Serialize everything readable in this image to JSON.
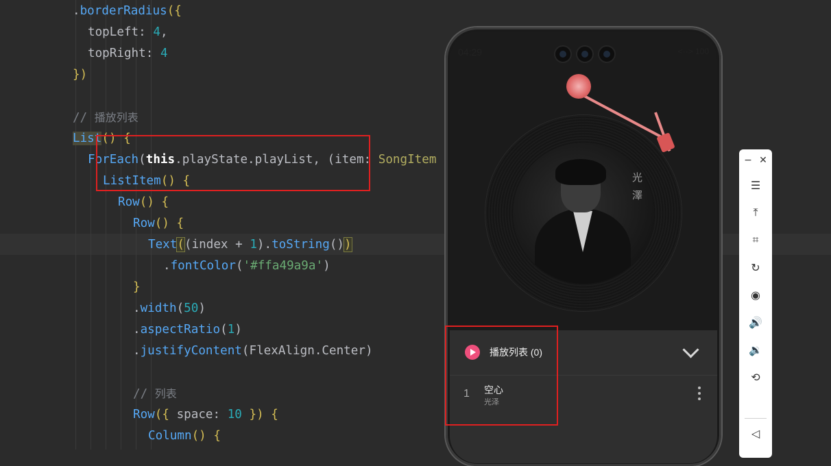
{
  "editor": {
    "lines": [
      {
        "segments": [
          {
            "t": ".",
            "c": "c-plain"
          },
          {
            "t": "borderRadius",
            "c": "c-fn"
          },
          {
            "t": "({",
            "c": "c-brace"
          }
        ]
      },
      {
        "segments": [
          {
            "t": "topLeft",
            "c": "c-plain"
          },
          {
            "t": ": ",
            "c": "c-plain"
          },
          {
            "t": "4",
            "c": "c-num"
          },
          {
            "t": ",",
            "c": "c-plain"
          }
        ]
      },
      {
        "segments": [
          {
            "t": "topRight",
            "c": "c-plain"
          },
          {
            "t": ": ",
            "c": "c-plain"
          },
          {
            "t": "4",
            "c": "c-num"
          }
        ]
      },
      {
        "segments": [
          {
            "t": "})",
            "c": "c-brace"
          }
        ]
      },
      {
        "segments": []
      },
      {
        "segments": [
          {
            "t": "// ",
            "c": "c-cm"
          },
          {
            "t": "播放列表",
            "c": "c-cm zh"
          }
        ]
      },
      {
        "segments": [
          {
            "t": "List",
            "c": "c-fn list-box"
          },
          {
            "t": "() {",
            "c": "c-brace"
          }
        ]
      },
      {
        "segments": [
          {
            "t": "ForEach",
            "c": "c-fn"
          },
          {
            "t": "(",
            "c": "c-plain"
          },
          {
            "t": "this",
            "c": "c-bold"
          },
          {
            "t": ".playState.playList, (",
            "c": "c-plain"
          },
          {
            "t": "item",
            "c": "c-plain"
          },
          {
            "t": ": ",
            "c": "c-plain"
          },
          {
            "t": "SongItem",
            "c": "c-type"
          }
        ]
      },
      {
        "segments": [
          {
            "t": "ListItem",
            "c": "c-fn"
          },
          {
            "t": "() {",
            "c": "c-brace"
          }
        ]
      },
      {
        "segments": [
          {
            "t": "Row",
            "c": "c-fn"
          },
          {
            "t": "() {",
            "c": "c-brace"
          }
        ]
      },
      {
        "segments": [
          {
            "t": "Row",
            "c": "c-fn"
          },
          {
            "t": "() {",
            "c": "c-brace"
          }
        ]
      },
      {
        "segments": [
          {
            "t": "Text",
            "c": "c-fn"
          },
          {
            "t": "(",
            "c": "c-brace brace-box"
          },
          {
            "t": "(index + ",
            "c": "c-plain"
          },
          {
            "t": "1",
            "c": "c-num"
          },
          {
            "t": ").",
            "c": "c-plain"
          },
          {
            "t": "toString",
            "c": "c-fn"
          },
          {
            "t": "()",
            "c": "c-plain"
          },
          {
            "t": ")",
            "c": "c-brace brace-box"
          }
        ]
      },
      {
        "segments": [
          {
            "t": ".",
            "c": "c-plain"
          },
          {
            "t": "fontColor",
            "c": "c-fn"
          },
          {
            "t": "(",
            "c": "c-plain"
          },
          {
            "t": "'#ffa49a9a'",
            "c": "c-str"
          },
          {
            "t": ")",
            "c": "c-plain"
          }
        ]
      },
      {
        "segments": [
          {
            "t": "}",
            "c": "c-brace"
          }
        ]
      },
      {
        "segments": [
          {
            "t": ".",
            "c": "c-plain"
          },
          {
            "t": "width",
            "c": "c-fn"
          },
          {
            "t": "(",
            "c": "c-plain"
          },
          {
            "t": "50",
            "c": "c-num"
          },
          {
            "t": ")",
            "c": "c-plain"
          }
        ]
      },
      {
        "segments": [
          {
            "t": ".",
            "c": "c-plain"
          },
          {
            "t": "aspectRatio",
            "c": "c-fn"
          },
          {
            "t": "(",
            "c": "c-plain"
          },
          {
            "t": "1",
            "c": "c-num"
          },
          {
            "t": ")",
            "c": "c-plain"
          }
        ]
      },
      {
        "segments": [
          {
            "t": ".",
            "c": "c-plain"
          },
          {
            "t": "justifyContent",
            "c": "c-fn"
          },
          {
            "t": "(FlexAlign.Center)",
            "c": "c-plain"
          }
        ]
      },
      {
        "segments": []
      },
      {
        "segments": [
          {
            "t": "// ",
            "c": "c-cm"
          },
          {
            "t": "列表",
            "c": "c-cm zh"
          }
        ]
      },
      {
        "segments": [
          {
            "t": "Row",
            "c": "c-fn"
          },
          {
            "t": "({ ",
            "c": "c-brace"
          },
          {
            "t": "space",
            "c": "c-plain"
          },
          {
            "t": ": ",
            "c": "c-plain"
          },
          {
            "t": "10",
            "c": "c-num"
          },
          {
            "t": " }) {",
            "c": "c-brace"
          }
        ]
      },
      {
        "segments": [
          {
            "t": "Column",
            "c": "c-fn"
          },
          {
            "t": "() {",
            "c": "c-brace"
          }
        ]
      }
    ]
  },
  "phone": {
    "status_time": "04:29",
    "status_right": "<··> 100",
    "cover_chars": [
      "光",
      "澤"
    ],
    "playlist": {
      "title": "播放列表 (0)",
      "songs": [
        {
          "index": "1",
          "name": "空心",
          "artist": "光泽"
        }
      ]
    }
  },
  "toolbar": {
    "minimize": "−",
    "close": "✕",
    "items": [
      {
        "name": "menu-icon",
        "glyph": "☰"
      },
      {
        "name": "pin-top-icon",
        "glyph": "⤒"
      },
      {
        "name": "crop-icon",
        "glyph": "⌗"
      },
      {
        "name": "rotate-icon",
        "glyph": "↻"
      },
      {
        "name": "screen-record-icon",
        "glyph": "◉"
      },
      {
        "name": "volume-up-icon",
        "glyph": "🔊"
      },
      {
        "name": "volume-down-icon",
        "glyph": "🔉"
      },
      {
        "name": "shake-icon",
        "glyph": "⟲"
      },
      {
        "name": "back-icon",
        "glyph": "◁"
      }
    ]
  },
  "colors": {
    "accent_pink": "#ee4f7c",
    "highlight_red": "#e02020",
    "editor_bg": "#2b2b2b"
  }
}
